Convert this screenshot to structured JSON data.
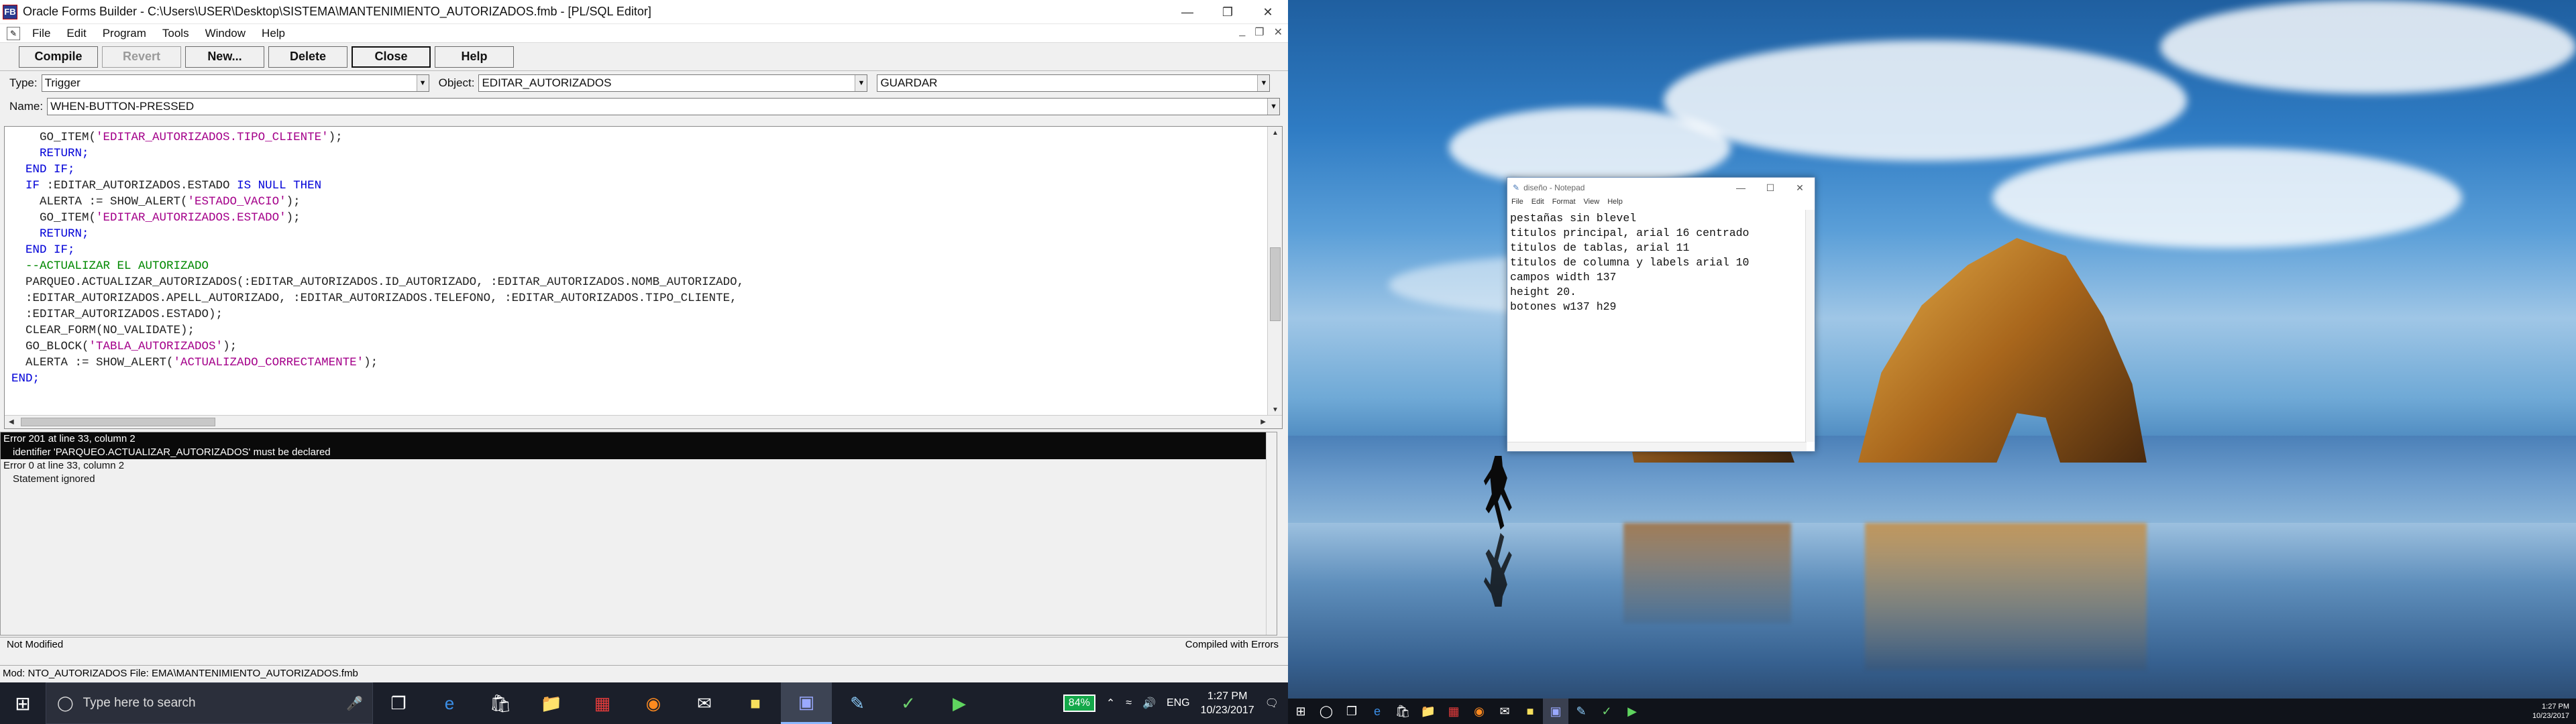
{
  "window": {
    "title": "Oracle Forms Builder - C:\\Users\\USER\\Desktop\\SISTEMA\\MANTENIMIENTO_AUTORIZADOS.fmb - [PL/SQL Editor]",
    "app_icon_text": "FB"
  },
  "menu": [
    "File",
    "Edit",
    "Program",
    "Tools",
    "Window",
    "Help"
  ],
  "toolbar": {
    "compile": "Compile",
    "revert": "Revert",
    "new": "New...",
    "delete": "Delete",
    "close": "Close",
    "help": "Help"
  },
  "selectors": {
    "type_label": "Type:",
    "type_value": "Trigger",
    "object_label": "Object:",
    "object_value": "EDITAR_AUTORIZADOS",
    "item_value": "GUARDAR",
    "name_label": "Name:",
    "name_value": "WHEN-BUTTON-PRESSED"
  },
  "code": [
    [
      {
        "c": "c-txt",
        "t": "    GO_ITEM("
      },
      {
        "c": "c-str",
        "t": "'EDITAR_AUTORIZADOS.TIPO_CLIENTE'"
      },
      {
        "c": "c-txt",
        "t": ");"
      }
    ],
    [
      {
        "c": "c-kw",
        "t": "    RETURN;"
      }
    ],
    [
      {
        "c": "c-kw",
        "t": "  END IF;"
      }
    ],
    [
      {
        "c": "c-kw",
        "t": "  IF "
      },
      {
        "c": "c-txt",
        "t": ":EDITAR_AUTORIZADOS.ESTADO "
      },
      {
        "c": "c-kw",
        "t": "IS NULL THEN"
      }
    ],
    [
      {
        "c": "c-txt",
        "t": "    ALERTA := SHOW_ALERT("
      },
      {
        "c": "c-str",
        "t": "'ESTADO_VACIO'"
      },
      {
        "c": "c-txt",
        "t": ");"
      }
    ],
    [
      {
        "c": "c-txt",
        "t": "    GO_ITEM("
      },
      {
        "c": "c-str",
        "t": "'EDITAR_AUTORIZADOS.ESTADO'"
      },
      {
        "c": "c-txt",
        "t": ");"
      }
    ],
    [
      {
        "c": "c-kw",
        "t": "    RETURN;"
      }
    ],
    [
      {
        "c": "c-kw",
        "t": "  END IF;"
      }
    ],
    [
      {
        "c": "c-cmt",
        "t": "  --ACTUALIZAR EL AUTORIZADO"
      }
    ],
    [
      {
        "c": "c-txt",
        "t": "  PARQUEO.ACTUALIZAR_AUTORIZADOS(:EDITAR_AUTORIZADOS.ID_AUTORIZADO, :EDITAR_AUTORIZADOS.NOMB_AUTORIZADO,"
      }
    ],
    [
      {
        "c": "c-txt",
        "t": "  :EDITAR_AUTORIZADOS.APELL_AUTORIZADO, :EDITAR_AUTORIZADOS.TELEFONO, :EDITAR_AUTORIZADOS.TIPO_CLIENTE,"
      }
    ],
    [
      {
        "c": "c-txt",
        "t": "  :EDITAR_AUTORIZADOS.ESTADO);"
      }
    ],
    [
      {
        "c": "c-txt",
        "t": "  CLEAR_FORM(NO_VALIDATE);"
      }
    ],
    [
      {
        "c": "c-txt",
        "t": "  GO_BLOCK("
      },
      {
        "c": "c-str",
        "t": "'TABLA_AUTORIZADOS'"
      },
      {
        "c": "c-txt",
        "t": ");"
      }
    ],
    [
      {
        "c": "c-txt",
        "t": "  ALERTA := SHOW_ALERT("
      },
      {
        "c": "c-str",
        "t": "'ACTUALIZADO_CORRECTAMENTE'"
      },
      {
        "c": "c-txt",
        "t": ");"
      }
    ],
    [
      {
        "c": "c-kw",
        "t": "END;"
      }
    ]
  ],
  "output": {
    "line1": "Error 201 at line 33, column 2",
    "line2": "identifier 'PARQUEO.ACTUALIZAR_AUTORIZADOS' must be declared",
    "line3": "Error 0 at line 33, column 2",
    "line4": "Statement ignored"
  },
  "status": {
    "left": "Not Modified",
    "right": "Compiled with Errors",
    "mod": "Mod: NTO_AUTORIZADOS File: EMA\\MANTENIMIENTO_AUTORIZADOS.fmb"
  },
  "taskbar": {
    "search_placeholder": "Type here to search",
    "battery": "84%",
    "lang": "ENG",
    "time": "1:27 PM",
    "date": "10/23/2017"
  },
  "notepad": {
    "title": "diseño - Notepad",
    "menu": [
      "File",
      "Edit",
      "Format",
      "View",
      "Help"
    ],
    "text": "pestañas sin blevel\ntitulos principal, arial 16 centrado\ntitulos de tablas, arial 11\ntitulos de columna y labels arial 10\ncampos width 137\nheight 20.\nbotones w137 h29"
  },
  "taskbar_right": {
    "time": "1:27 PM",
    "date": "10/23/2017"
  },
  "colors": {
    "keyword": "#0000d8",
    "string": "#a4008a",
    "comment": "#008800",
    "battery": "#14a84a"
  }
}
